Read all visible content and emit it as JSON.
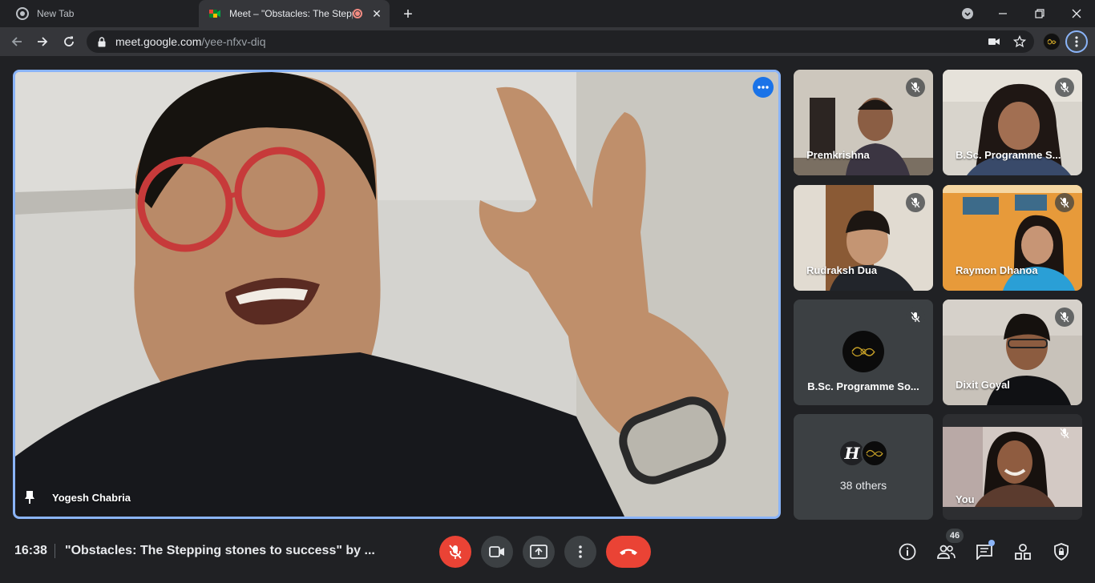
{
  "browser": {
    "tabs": [
      {
        "title": "New Tab",
        "icon": "chrome-icon"
      },
      {
        "title": "Meet – \"Obstacles: The Stepping",
        "icon": "meet-icon",
        "recording": true
      }
    ],
    "url_host": "meet.google.com",
    "url_path": "/yee-nfxv-diq"
  },
  "main_speaker": {
    "name": "Yogesh Chabria",
    "pinned": true
  },
  "participants": [
    {
      "name": "Premkrishna",
      "muted": true
    },
    {
      "name": "B.Sc. Programme S...",
      "muted": true
    },
    {
      "name": "Rudraksh Dua",
      "muted": true
    },
    {
      "name": "Raymon Dhanoa",
      "muted": true
    },
    {
      "name": "B.Sc. Programme So...",
      "muted": true,
      "avatar": "logo"
    },
    {
      "name": "Dixit Goyal",
      "muted": true
    },
    {
      "name": "You",
      "muted": true
    }
  ],
  "others": {
    "avatar_letter": "H",
    "label": "38 others"
  },
  "bottom": {
    "time": "16:38",
    "meeting_title": "\"Obstacles: The Stepping stones to success\" by ...",
    "participant_count": "46"
  },
  "colors": {
    "accent": "#8ab4f8",
    "danger": "#ea4335",
    "surface": "#3c4043",
    "background": "#202124"
  }
}
